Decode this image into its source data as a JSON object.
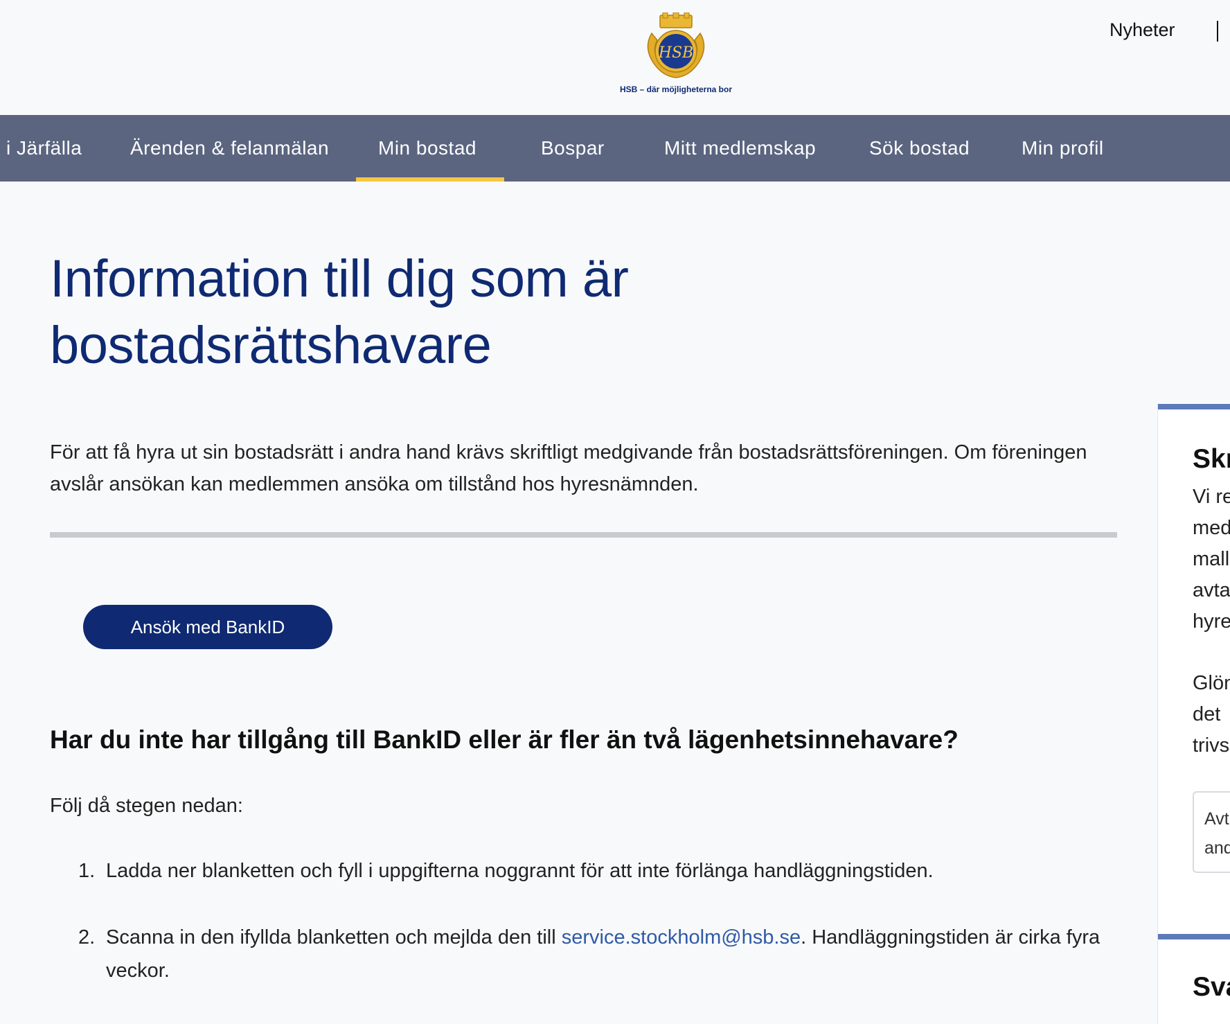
{
  "header": {
    "logo_tagline": "HSB – där möjligheterna bor",
    "logo_monogram": "HSB",
    "utility_link": "Nyheter"
  },
  "nav": {
    "items": [
      {
        "label": "l i Järfälla",
        "active": false
      },
      {
        "label": "Ärenden & felanmälan",
        "active": false
      },
      {
        "label": "Min bostad",
        "active": true
      },
      {
        "label": "Bospar",
        "active": false
      },
      {
        "label": "Mitt medlemskap",
        "active": false
      },
      {
        "label": "Sök bostad",
        "active": false
      },
      {
        "label": "Min profil",
        "active": false
      }
    ]
  },
  "main": {
    "title": "Information till dig som är bostadsrättshavare",
    "intro": "För att få hyra ut sin bostadsrätt i andra hand krävs skriftligt medgivande från bostadsrättsföreningen. Om föreningen avslår ansökan kan medlemmen ansöka om tillstånd hos hyresnämnden.",
    "apply_button": "Ansök med BankID",
    "subheading": "Har du inte har tillgång till BankID eller är fler än två lägenhetsinnehavare?",
    "follow_text": "Följ då stegen nedan:",
    "steps": [
      {
        "number": "1.",
        "text": "Ladda ner blanketten och fyll i uppgifterna noggrannt för att inte förlänga handläggningstiden."
      },
      {
        "number": "2.",
        "text_before": "Scanna in den ifyllda blanketten och mejlda den till ",
        "link": "service.stockholm@hsb.se",
        "text_after": ". Handläggningstiden är cirka fyra veckor."
      }
    ]
  },
  "sidebar": {
    "card1": {
      "title": "Skr",
      "lines": [
        "Vi re",
        "med",
        "mall",
        "avta",
        "hyre",
        "Glön",
        "det",
        "trivs"
      ],
      "box_lines": [
        "Avt",
        "and"
      ]
    },
    "card2": {
      "title": "Sva"
    }
  },
  "colors": {
    "brand_navy": "#0f2a72",
    "nav_bg": "#5b6580",
    "active_indicator": "#f6c744",
    "link": "#2f5aa8",
    "card_accent": "#5b7ab8"
  }
}
